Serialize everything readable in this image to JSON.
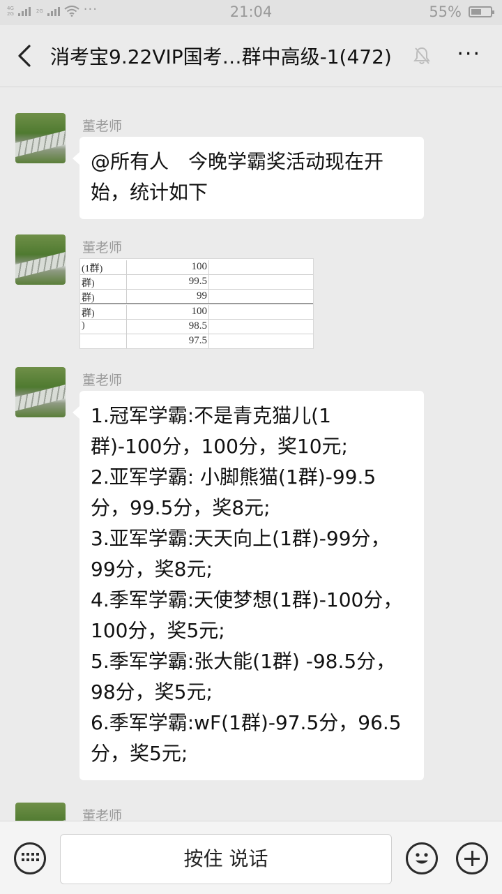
{
  "status_bar": {
    "network": [
      "4G",
      "2G"
    ],
    "network2": "2G",
    "more": "···",
    "time": "21:04",
    "battery": "55%",
    "battery_level": 0.55
  },
  "header": {
    "title": "消考宝9.22VIP国考…群中高级-1(472)",
    "back_icon": "chevron-left-icon",
    "mute_icon": "bell-muted-icon",
    "more_label": "···"
  },
  "messages": [
    {
      "sender": "董老师",
      "type": "text",
      "lines": [
        "@所有人　今晚学霸奖活动现在开",
        "始，统计如下"
      ]
    },
    {
      "sender": "董老师",
      "type": "image",
      "rows": [
        {
          "name": "(1群)",
          "value": "100"
        },
        {
          "name": "群)",
          "value": "99.5"
        },
        {
          "name": "群)",
          "value": "99"
        },
        {
          "name": "群)",
          "value": "100"
        },
        {
          "name": ")",
          "value": "98.5"
        },
        {
          "name": "",
          "value": "97.5"
        }
      ]
    },
    {
      "sender": "董老师",
      "type": "text",
      "lines": [
        "1.冠军学霸:不是青克猫儿(1",
        "群)-100分，100分，奖10元;",
        "2.亚军学霸: 小脚熊猫(1群)-99.5",
        "分，99.5分，奖8元;",
        "3.亚军学霸:天天向上(1群)-99分，",
        "99分，奖8元;",
        "4.季军学霸:天使梦想(1群)-100分，",
        "100分，奖5元;",
        "5.季军学霸:张大能(1群) -98.5分，",
        "98分，奖5元;",
        "6.季军学霸:wF(1群)-97.5分，96.5",
        "分，奖5元;"
      ]
    },
    {
      "sender": "董老师",
      "type": "partial"
    }
  ],
  "input_bar": {
    "keyboard_icon": "keyboard-icon",
    "hold_to_talk": "按住 说话",
    "emoji_icon": "emoji-icon",
    "plus_icon": "plus-icon"
  }
}
